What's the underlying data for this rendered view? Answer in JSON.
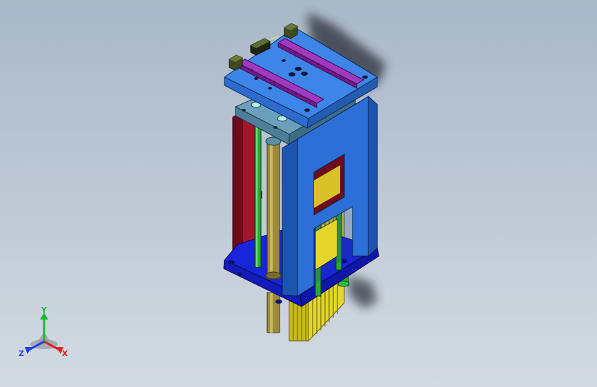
{
  "viewport": {
    "background_top": "#a9b8c8",
    "background_bottom": "#d3dae2"
  },
  "model": {
    "part_colors": {
      "top_plate": "#3d86e8",
      "rail": "#8e2aa8",
      "upright_frame": "#2c6fd6",
      "base_plate": "#1a24d8",
      "side_panel": "#a3142e",
      "guide_rod": "#28a93a",
      "threaded_rod": "#9c8a3a",
      "support_block": "#5a8fa8",
      "bellows": "#e0d428"
    }
  },
  "triad": {
    "icon": "coordinate-triad-icon",
    "x_label": "X",
    "y_label": "Y",
    "z_label": "Z",
    "x_color": "#e02020",
    "y_color": "#18b830",
    "z_color": "#2040e0"
  }
}
